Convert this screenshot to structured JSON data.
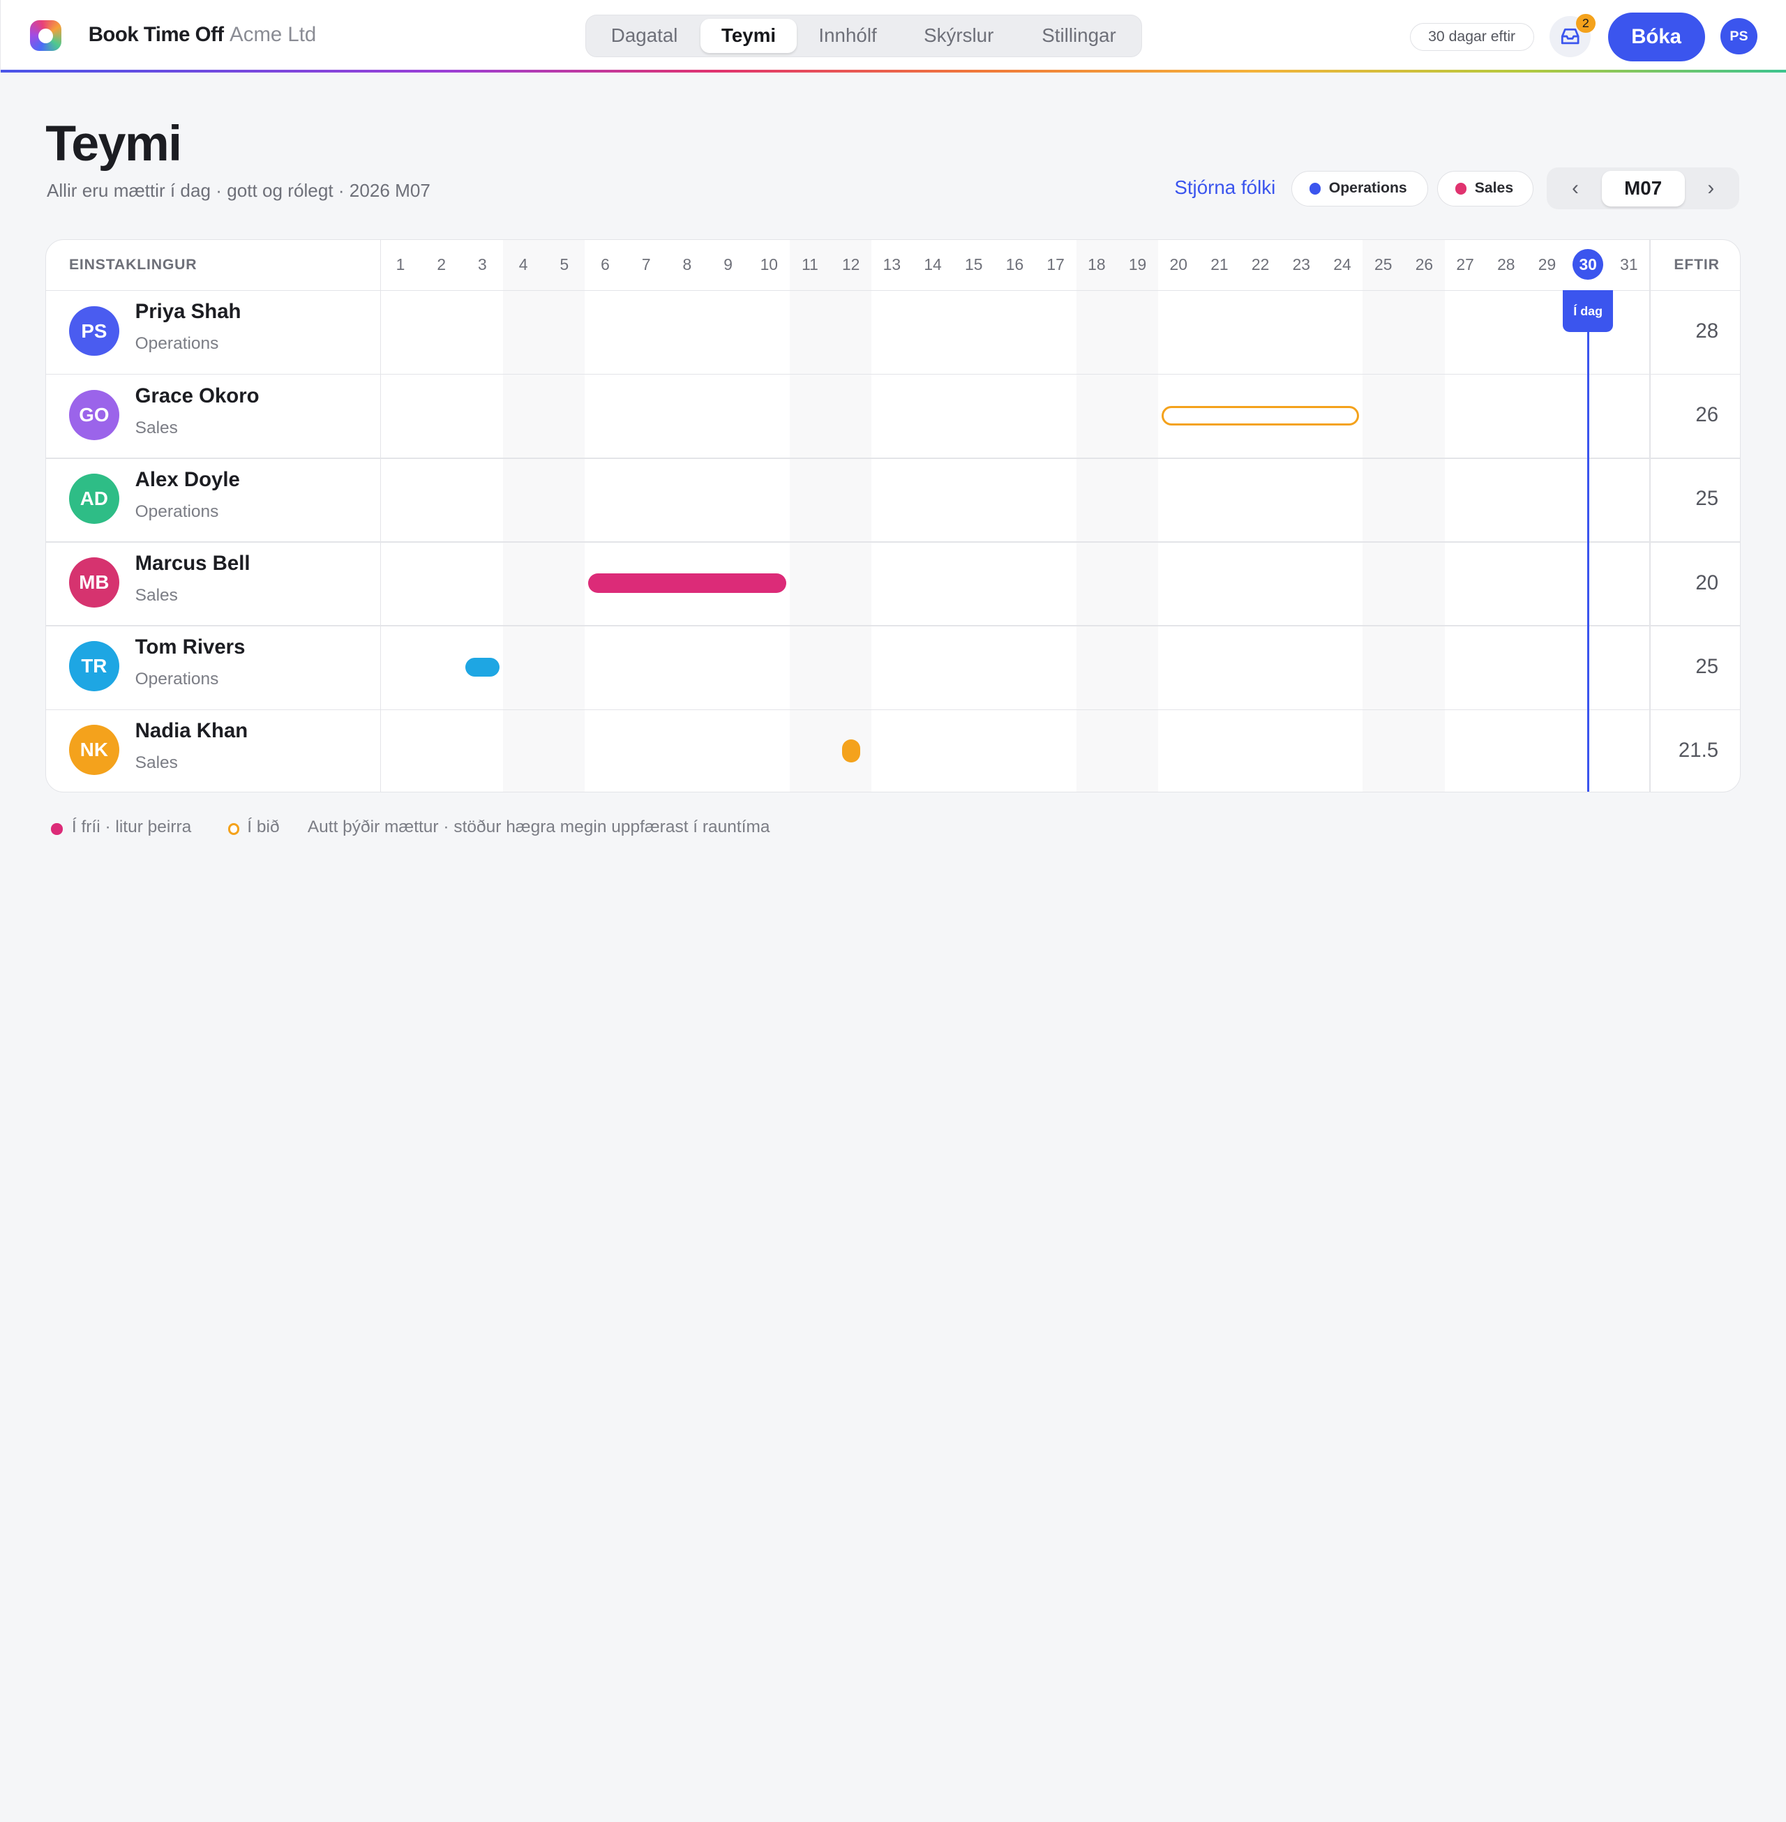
{
  "app": {
    "name": "Book Time Off",
    "company": "Acme Ltd",
    "days_left": "30 dagar eftir",
    "inbox_count": "2",
    "book_label": "Bóka",
    "user_initials": "PS",
    "accent": "#3b55ee"
  },
  "nav": {
    "tabs": [
      {
        "label": "Dagatal",
        "active": false
      },
      {
        "label": "Teymi",
        "active": true
      },
      {
        "label": "Innhólf",
        "active": false
      },
      {
        "label": "Skýrslur",
        "active": false
      },
      {
        "label": "Stillingar",
        "active": false
      }
    ]
  },
  "page": {
    "title": "Teymi",
    "subtitle": "Allir eru mættir í dag · gott og rólegt · 2026 M07",
    "manage_label": "Stjórna fólki",
    "filters": [
      {
        "label": "Operations",
        "color": "#3b55ee"
      },
      {
        "label": "Sales",
        "color": "#e0336f"
      }
    ],
    "month": "M07",
    "prev_icon": "‹",
    "next_icon": "›"
  },
  "grid": {
    "person_header": "EINSTAKLINGUR",
    "remaining_header": "EFTIR",
    "days": [
      "1",
      "2",
      "3",
      "4",
      "5",
      "6",
      "7",
      "8",
      "9",
      "10",
      "11",
      "12",
      "13",
      "14",
      "15",
      "16",
      "17",
      "18",
      "19",
      "20",
      "21",
      "22",
      "23",
      "24",
      "25",
      "26",
      "27",
      "28",
      "29",
      "30",
      "31"
    ],
    "weekend_days": [
      4,
      5,
      11,
      12,
      18,
      19,
      25,
      26
    ],
    "today": 30,
    "today_label": "Í dag",
    "people": [
      {
        "initials": "PS",
        "name": "Priya Shah",
        "team": "Operations",
        "remaining": "28",
        "color": "#4a5cf0",
        "leave": []
      },
      {
        "initials": "GO",
        "name": "Grace Okoro",
        "team": "Sales",
        "remaining": "26",
        "color": "#9b64ea",
        "leave": [
          {
            "start": 20,
            "end": 24,
            "status": "pending",
            "color": "#f4a21c"
          }
        ]
      },
      {
        "initials": "AD",
        "name": "Alex Doyle",
        "team": "Operations",
        "remaining": "25",
        "color": "#2ebd86",
        "leave": []
      },
      {
        "initials": "MB",
        "name": "Marcus Bell",
        "team": "Sales",
        "remaining": "20",
        "color": "#d6336f",
        "leave": [
          {
            "start": 6,
            "end": 10,
            "status": "approved",
            "color": "#dc2b78"
          }
        ]
      },
      {
        "initials": "TR",
        "name": "Tom Rivers",
        "team": "Operations",
        "remaining": "25",
        "color": "#1ea6e3",
        "leave": [
          {
            "start": 3,
            "end": 3,
            "status": "approved",
            "color": "#1ea6e3"
          }
        ]
      },
      {
        "initials": "NK",
        "name": "Nadia Khan",
        "team": "Sales",
        "remaining": "21.5",
        "color": "#f4a21c",
        "leave": [
          {
            "start": 12,
            "end": 12,
            "half": true,
            "status": "approved",
            "color": "#f4a21c"
          }
        ]
      }
    ]
  },
  "legend": {
    "off_label": "Í fríi · litur þeirra",
    "off_color": "#dc2b78",
    "pending_label": "Í bið",
    "pending_color": "#f4a21c",
    "note": "Autt þýðir mættur · stöður hægra megin uppfærast í rauntíma"
  }
}
